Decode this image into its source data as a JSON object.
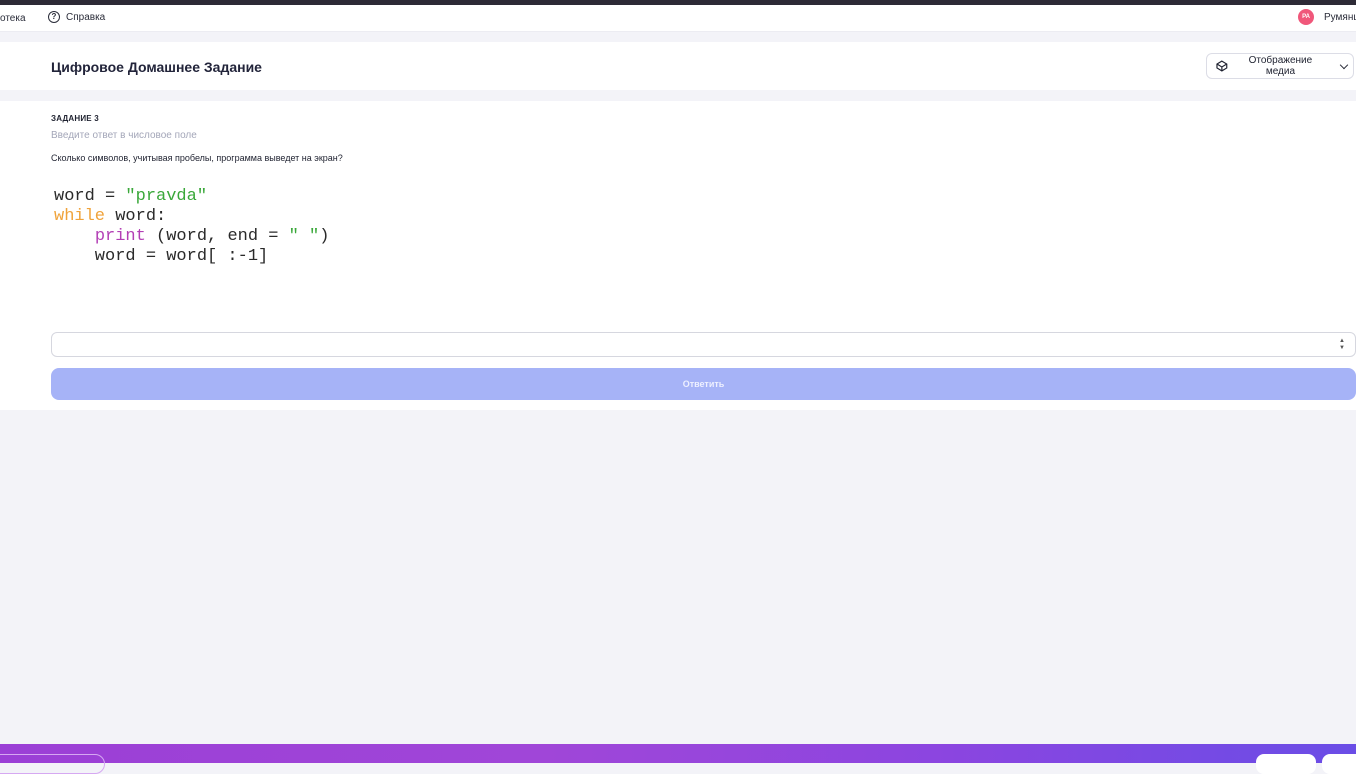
{
  "topnav": {
    "library_label": "отека",
    "help_label": "Справка",
    "help_icon": "question-circle-icon",
    "user_initials": "РА",
    "user_name": "Румянц"
  },
  "header": {
    "title": "Цифровое Домашнее Задание",
    "media_button_label": "Отображение медиа",
    "media_icon": "box-icon"
  },
  "task": {
    "label": "ЗАДАНИЕ 3",
    "hint": "Введите ответ в числовое поле",
    "question": "Сколько символов, учитывая пробелы, программа выведет на экран?",
    "code": {
      "line1_var": "word = ",
      "line1_str": "\"pravda\"",
      "line2_kw": "while",
      "line2_rest": " word:",
      "line3_indent": "    ",
      "line3_fn": "print",
      "line3_rest_a": " (word, end = ",
      "line3_str": "\" \"",
      "line3_rest_b": ")",
      "line4": "    word = word[ :-1]"
    },
    "answer_value": "",
    "answer_button_label": "Ответить"
  },
  "colors": {
    "accent_button": "#a6b3f7",
    "avatar": "#f0577a",
    "keyword_orange": "#f0a33a",
    "keyword_purple": "#b33fb5",
    "string_green": "#3aa83a",
    "bottom_gradient_start": "#9b3fd6",
    "bottom_gradient_end": "#6a4de6"
  }
}
